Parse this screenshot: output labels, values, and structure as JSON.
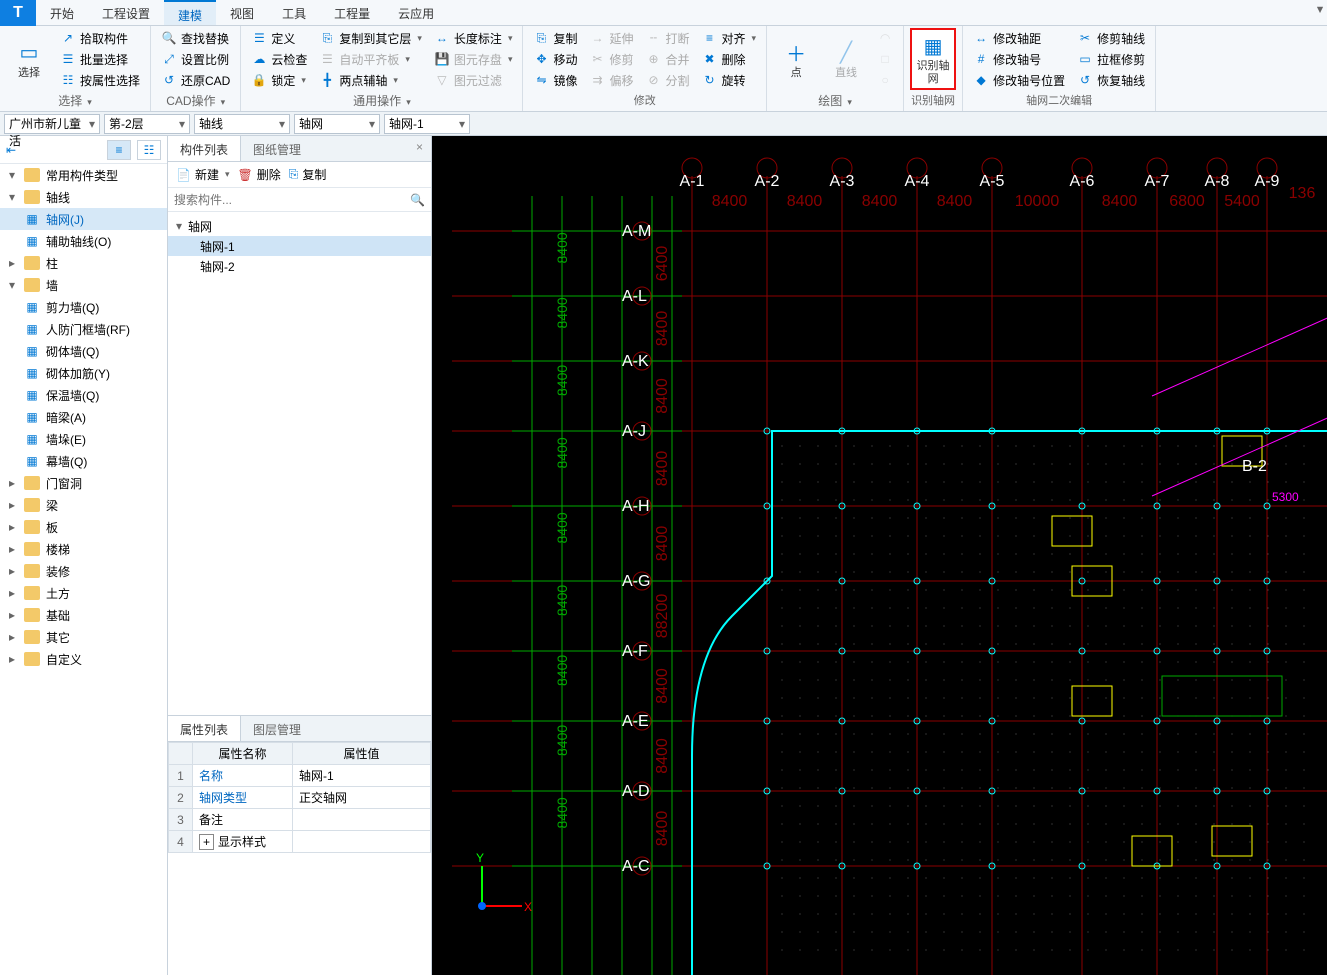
{
  "tabs": [
    "开始",
    "工程设置",
    "建模",
    "视图",
    "工具",
    "工程量",
    "云应用"
  ],
  "tabs_active": 2,
  "ribbon": {
    "select": {
      "big": "选择",
      "items": [
        "拾取构件",
        "批量选择",
        "按属性选择"
      ],
      "label": "选择"
    },
    "cad": {
      "items": [
        "查找替换",
        "设置比例",
        "还原CAD"
      ],
      "label": "CAD操作"
    },
    "common": {
      "items": [
        [
          "定义",
          "复制到其它层",
          "长度标注"
        ],
        [
          "云检查",
          "自动平齐板",
          "图元存盘"
        ],
        [
          "锁定",
          "两点辅轴",
          "图元过滤"
        ]
      ],
      "label": "通用操作"
    },
    "modify": {
      "items": [
        [
          "复制",
          "延伸",
          "打断",
          "对齐"
        ],
        [
          "移动",
          "修剪",
          "合并",
          "删除"
        ],
        [
          "镜像",
          "偏移",
          "分割",
          "旋转"
        ]
      ],
      "label": "修改"
    },
    "draw": {
      "bigs": [
        "点",
        "直线"
      ],
      "label": "绘图"
    },
    "recog": {
      "big": "识别轴网",
      "label": "识别轴网"
    },
    "edit2": {
      "items": [
        [
          "修改轴距",
          "修剪轴线"
        ],
        [
          "修改轴号",
          "拉框修剪"
        ],
        [
          "修改轴号位置",
          "恢复轴线"
        ]
      ],
      "label": "轴网二次编辑"
    }
  },
  "selectors": {
    "project": "广州市新儿童活",
    "floor": "第-2层",
    "cat": "轴线",
    "type": "轴网",
    "inst": "轴网-1"
  },
  "left": {
    "header_icons": [
      "≡",
      "☷"
    ],
    "tree": [
      {
        "t": "常用构件类型",
        "k": "cat",
        "exp": true
      },
      {
        "t": "轴线",
        "k": "cat",
        "exp": true
      },
      {
        "t": "轴网(J)",
        "k": "item",
        "sel": true,
        "icon": "grid"
      },
      {
        "t": "辅助轴线(O)",
        "k": "item",
        "icon": "grid"
      },
      {
        "t": "柱",
        "k": "cat"
      },
      {
        "t": "墙",
        "k": "cat",
        "exp": true
      },
      {
        "t": "剪力墙(Q)",
        "k": "item",
        "icon": "wall"
      },
      {
        "t": "人防门框墙(RF)",
        "k": "item",
        "icon": "wall"
      },
      {
        "t": "砌体墙(Q)",
        "k": "item",
        "icon": "wall"
      },
      {
        "t": "砌体加筋(Y)",
        "k": "item",
        "icon": "wall"
      },
      {
        "t": "保温墙(Q)",
        "k": "item",
        "icon": "wall"
      },
      {
        "t": "暗梁(A)",
        "k": "item",
        "icon": "wall"
      },
      {
        "t": "墙垛(E)",
        "k": "item",
        "icon": "wall"
      },
      {
        "t": "幕墙(Q)",
        "k": "item",
        "icon": "wall"
      },
      {
        "t": "门窗洞",
        "k": "cat"
      },
      {
        "t": "梁",
        "k": "cat"
      },
      {
        "t": "板",
        "k": "cat"
      },
      {
        "t": "楼梯",
        "k": "cat"
      },
      {
        "t": "装修",
        "k": "cat"
      },
      {
        "t": "土方",
        "k": "cat"
      },
      {
        "t": "基础",
        "k": "cat"
      },
      {
        "t": "其它",
        "k": "cat"
      },
      {
        "t": "自定义",
        "k": "cat"
      }
    ]
  },
  "mid": {
    "tabs": [
      "构件列表",
      "图纸管理"
    ],
    "toolbar": [
      "新建",
      "删除",
      "复制"
    ],
    "search_ph": "搜索构件...",
    "items": {
      "parent": "轴网",
      "children": [
        "轴网-1",
        "轴网-2"
      ],
      "sel": 0
    },
    "prop_tabs": [
      "属性列表",
      "图层管理"
    ],
    "prop_headers": [
      "属性名称",
      "属性值"
    ],
    "props": [
      {
        "n": "名称",
        "v": "轴网-1"
      },
      {
        "n": "轴网类型",
        "v": "正交轴网",
        "lk": true
      },
      {
        "n": "备注",
        "v": ""
      },
      {
        "n": "显示样式",
        "v": "",
        "exp": true
      }
    ]
  },
  "canvas": {
    "cols": {
      "labels": [
        "A-1",
        "A-2",
        "A-3",
        "A-4",
        "A-5",
        "A-6",
        "A-7",
        "A-8",
        "A-9"
      ],
      "dims": [
        "8400",
        "8400",
        "8400",
        "8400",
        "10000",
        "8400",
        "6800",
        "5400"
      ],
      "total": "136"
    },
    "rows": {
      "labels": [
        "A-M",
        "A-L",
        "A-K",
        "A-J",
        "A-H",
        "A-G",
        "A-F",
        "A-E",
        "A-D",
        "A-C"
      ],
      "dims": [
        "6400",
        "8400",
        "8400",
        "8400",
        "8400",
        "88200\n8400",
        "8400",
        "8400",
        "8400",
        "8400"
      ]
    },
    "axes": {
      "x": "X",
      "y": "Y"
    },
    "b2": "B-2",
    "b2dim": "5300"
  }
}
